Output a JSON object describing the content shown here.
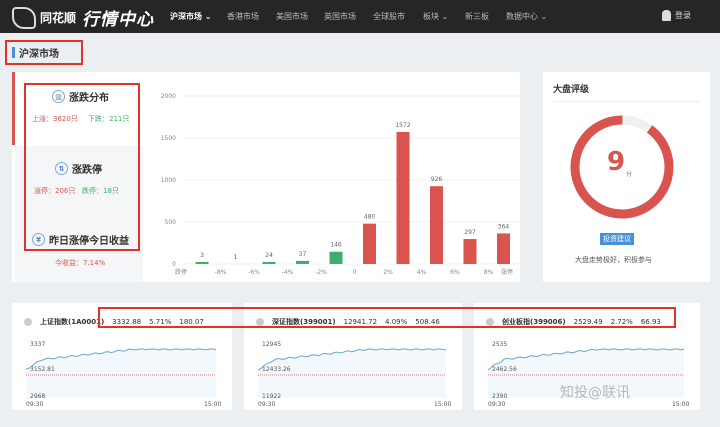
{
  "nav": {
    "brand": "同花顺",
    "title": "行情中心",
    "items": [
      {
        "label": "沪深市场 ⌄",
        "active": true
      },
      {
        "label": "香港市场"
      },
      {
        "label": "美国市场"
      },
      {
        "label": "英国市场"
      },
      {
        "label": "全球股市"
      },
      {
        "label": "板块 ⌄"
      },
      {
        "label": "新三板"
      },
      {
        "label": "数据中心 ⌄"
      }
    ],
    "login": "登录"
  },
  "section_title": "沪深市场",
  "side": {
    "dist_title": "涨跌分布",
    "up": "上涨：3620只",
    "down": "下跌：211只",
    "limit_title": "涨跌停",
    "limit_up": "涨停：206只",
    "limit_down": "跌停：18只",
    "yield_title": "昨日涨停今日收益",
    "yield": "今收益：7.14%"
  },
  "chart_data": {
    "type": "bar",
    "ylim": [
      0,
      2000
    ],
    "yticks": [
      0,
      500,
      1000,
      1500,
      2000
    ],
    "xticks": [
      "跌停",
      "-8%",
      "-6%",
      "-4%",
      "-2%",
      "0",
      "2%",
      "4%",
      "6%",
      "8%",
      "涨停"
    ],
    "values": [
      3,
      1,
      24,
      37,
      146,
      480,
      1572,
      926,
      297,
      364
    ],
    "colors": [
      "#3fae6a",
      "#3fae6a",
      "#3fae6a",
      "#3fae6a",
      "#3fae6a",
      "#d9534f",
      "#d9534f",
      "#d9534f",
      "#d9534f",
      "#d9534f"
    ],
    "grid": true
  },
  "rating": {
    "title": "大盘评级",
    "score": "9",
    "unit": "分",
    "score_fraction": 0.9,
    "badge": "投资建议",
    "advice": "大盘走势极好，积极参与",
    "color": "#d9534f"
  },
  "indices": [
    {
      "name": "上证指数(1A0001)",
      "price": "3332.88",
      "pct": "5.71%",
      "chg": "180.07",
      "high": "3337",
      "base": "3152.81",
      "low": "2968",
      "t0": "09:30",
      "t1": "15:00"
    },
    {
      "name": "深证指数(399001)",
      "price": "12941.72",
      "pct": "4.09%",
      "chg": "508.46",
      "high": "12945",
      "base": "12433.26",
      "low": "11922",
      "t0": "09:30",
      "t1": "15:00"
    },
    {
      "name": "创业板指(399006)",
      "price": "2529.49",
      "pct": "2.72%",
      "chg": "66.93",
      "high": "2535",
      "base": "2462.56",
      "low": "2390",
      "t0": "09:30",
      "t1": "15:00"
    }
  ],
  "watermark": "知投@联讯"
}
